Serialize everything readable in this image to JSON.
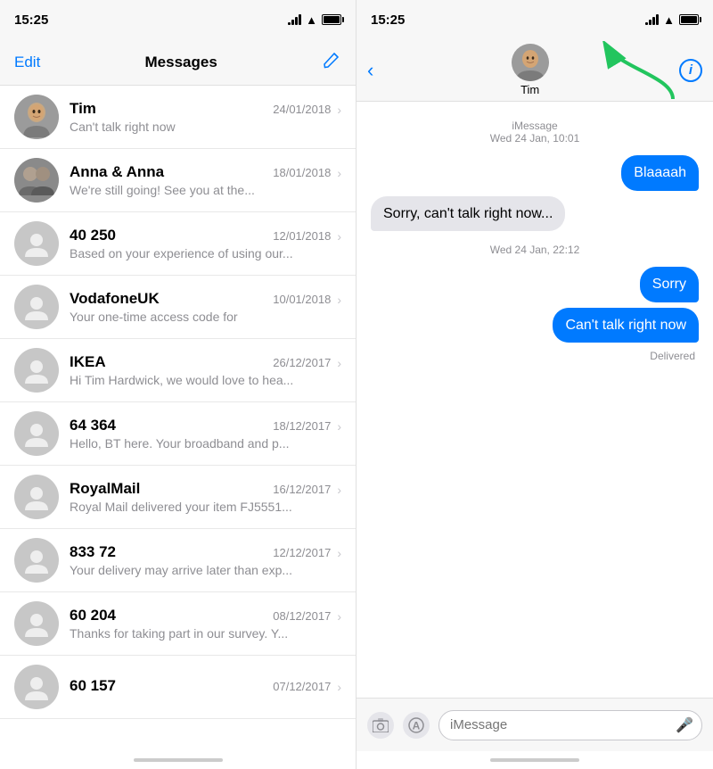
{
  "left": {
    "status_time": "15:25",
    "nav": {
      "edit_label": "Edit",
      "title": "Messages",
      "compose_symbol": "✏"
    },
    "conversations": [
      {
        "name": "Tim",
        "date": "24/01/2018",
        "preview": "Can't talk right now",
        "has_real_avatar": true
      },
      {
        "name": "Anna & Anna",
        "date": "18/01/2018",
        "preview": "We're still going! See you at the...",
        "has_group_avatar": true
      },
      {
        "name": "40 250",
        "date": "12/01/2018",
        "preview": "Based on your experience of using our..."
      },
      {
        "name": "VodafoneUK",
        "date": "10/01/2018",
        "preview": "Your one-time access code for"
      },
      {
        "name": "IKEA",
        "date": "26/12/2017",
        "preview": "Hi Tim Hardwick, we would love to hea..."
      },
      {
        "name": "64 364",
        "date": "18/12/2017",
        "preview": "Hello, BT here. Your broadband and p..."
      },
      {
        "name": "RoyalMail",
        "date": "16/12/2017",
        "preview": "Royal Mail delivered your item FJ5551..."
      },
      {
        "name": "833 72",
        "date": "12/12/2017",
        "preview": "Your delivery may arrive later than exp..."
      },
      {
        "name": "60 204",
        "date": "08/12/2017",
        "preview": "Thanks for taking part in our survey. Y..."
      },
      {
        "name": "60 157",
        "date": "07/12/2017",
        "preview": ""
      }
    ]
  },
  "right": {
    "status_time": "15:25",
    "contact_name": "Tim",
    "system_msg1": "iMessage",
    "system_date1": "Wed 24 Jan, 10:01",
    "system_date2": "Wed 24 Jan, 22:12",
    "messages": [
      {
        "type": "sent",
        "text": "Blaaaah"
      },
      {
        "type": "received",
        "text": "Sorry, can't talk right now..."
      },
      {
        "type": "sent",
        "text": "Sorry"
      },
      {
        "type": "sent",
        "text": "Can't talk right now"
      }
    ],
    "delivered_label": "Delivered",
    "input_placeholder": "iMessage"
  }
}
